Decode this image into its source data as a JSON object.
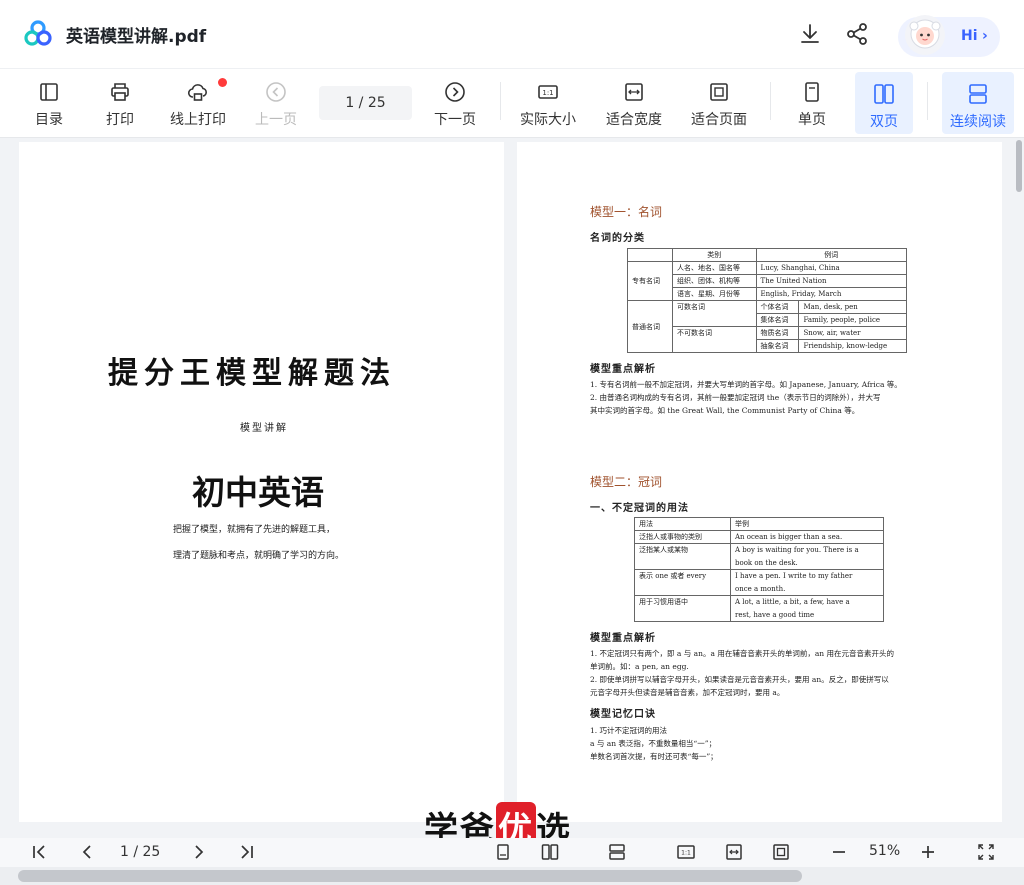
{
  "app": {
    "doc_title": "英语模型讲解.pdf",
    "hi_label": "Hi",
    "hi_chevron": "›"
  },
  "toolbar": {
    "toc": "目录",
    "print": "打印",
    "online_print": "线上打印",
    "prev_page": "上一页",
    "page_indicator": "1  /  25",
    "next_page": "下一页",
    "actual_size": "实际大小",
    "fit_width": "适合宽度",
    "fit_page": "适合页面",
    "single_page": "单页",
    "double_page": "双页",
    "continuous": "连续阅读"
  },
  "cover": {
    "title": "提分王模型解题法",
    "subtitle": "模型讲解",
    "main": "初中英语",
    "line1": "把握了模型，就拥有了先进的解题工具，",
    "line2": "理清了题脉和考点，就明确了学习的方向。"
  },
  "right_page": {
    "model1_title": "模型一：名词",
    "noun_class_heading": "名词的分类",
    "noun_table": {
      "headers": [
        "类别",
        "例词"
      ],
      "proper_label": "专有名词",
      "common_label": "普通名词",
      "proper_rows": [
        [
          "人名、地名、国名等",
          "Lucy, Shanghai, China"
        ],
        [
          "组织、团体、机构等",
          "The United Nation"
        ],
        [
          "语言、星期、月份等",
          "English, Friday, March"
        ]
      ],
      "countable": "可数名词",
      "uncountable": "不可数名词",
      "common_rows": [
        [
          "个体名词",
          "Man, desk, pen"
        ],
        [
          "集体名词",
          "Family, people, police"
        ],
        [
          "物质名词",
          "Snow, air, water"
        ],
        [
          "抽象名词",
          "Friendship, know-ledge"
        ]
      ]
    },
    "key_points_heading": "模型重点解析",
    "noun_notes": [
      "1. 专有名词前一般不加定冠词，并要大写单词的首字母。如 Japanese, January, Africa 等。",
      "2. 由普通名词构成的专有名词，其前一般要加定冠词 the（表示节日的词除外），并大写",
      "其中实词的首字母。如 the Great Wall, the Communist Party of China 等。"
    ],
    "model2_title": "模型二：冠词",
    "indef_heading": "一、不定冠词的用法",
    "article_table": {
      "headers": [
        "用法",
        "举例"
      ],
      "rows": [
        [
          "泛指人或事物的类别",
          "An ocean is bigger than a sea."
        ],
        [
          "泛指某人或某物",
          "A boy is waiting for you. There is a"
        ],
        [
          "",
          "book on the desk."
        ],
        [
          "表示 one 或者 every",
          "I have a pen. I write to my father"
        ],
        [
          "",
          "once a month."
        ],
        [
          "用于习惯用语中",
          "A lot, a little, a bit, a few, have a"
        ],
        [
          "",
          "rest, have a good time"
        ]
      ]
    },
    "key_points_heading2": "模型重点解析",
    "article_notes": [
      "1. 不定冠词只有两个，即 a 与 an。a 用在辅音音素开头的单词前，an 用在元音音素开头的",
      "单词前。如：a pen, an egg.",
      "2. 即使单词拼写以辅音字母开头，如果读音是元音音素开头，要用 an。反之，即使拼写以",
      "元音字母开头但读音是辅音音素，加不定冠词时，要用 a。"
    ],
    "memory_heading": "模型记忆口诀",
    "memory_lines": [
      "1.   巧计不定冠词的用法",
      "a 与 an 表泛指，不重数量相当“一”；",
      "单数名词首次提，有时还可表“每一”；"
    ]
  },
  "watermark": {
    "part1": "学爸",
    "part2": "优",
    "part3": "选"
  },
  "bottom": {
    "page_indicator": "1  / 25",
    "zoom": "51%"
  }
}
